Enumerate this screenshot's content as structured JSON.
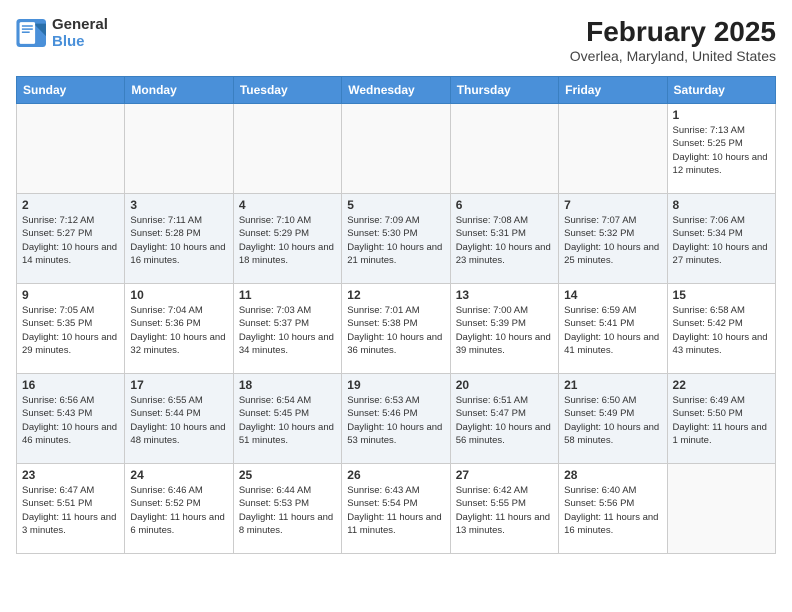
{
  "logo": {
    "name1": "General",
    "name2": "Blue"
  },
  "title": "February 2025",
  "subtitle": "Overlea, Maryland, United States",
  "days_of_week": [
    "Sunday",
    "Monday",
    "Tuesday",
    "Wednesday",
    "Thursday",
    "Friday",
    "Saturday"
  ],
  "weeks": [
    [
      {
        "day": "",
        "info": ""
      },
      {
        "day": "",
        "info": ""
      },
      {
        "day": "",
        "info": ""
      },
      {
        "day": "",
        "info": ""
      },
      {
        "day": "",
        "info": ""
      },
      {
        "day": "",
        "info": ""
      },
      {
        "day": "1",
        "info": "Sunrise: 7:13 AM\nSunset: 5:25 PM\nDaylight: 10 hours and 12 minutes."
      }
    ],
    [
      {
        "day": "2",
        "info": "Sunrise: 7:12 AM\nSunset: 5:27 PM\nDaylight: 10 hours and 14 minutes."
      },
      {
        "day": "3",
        "info": "Sunrise: 7:11 AM\nSunset: 5:28 PM\nDaylight: 10 hours and 16 minutes."
      },
      {
        "day": "4",
        "info": "Sunrise: 7:10 AM\nSunset: 5:29 PM\nDaylight: 10 hours and 18 minutes."
      },
      {
        "day": "5",
        "info": "Sunrise: 7:09 AM\nSunset: 5:30 PM\nDaylight: 10 hours and 21 minutes."
      },
      {
        "day": "6",
        "info": "Sunrise: 7:08 AM\nSunset: 5:31 PM\nDaylight: 10 hours and 23 minutes."
      },
      {
        "day": "7",
        "info": "Sunrise: 7:07 AM\nSunset: 5:32 PM\nDaylight: 10 hours and 25 minutes."
      },
      {
        "day": "8",
        "info": "Sunrise: 7:06 AM\nSunset: 5:34 PM\nDaylight: 10 hours and 27 minutes."
      }
    ],
    [
      {
        "day": "9",
        "info": "Sunrise: 7:05 AM\nSunset: 5:35 PM\nDaylight: 10 hours and 29 minutes."
      },
      {
        "day": "10",
        "info": "Sunrise: 7:04 AM\nSunset: 5:36 PM\nDaylight: 10 hours and 32 minutes."
      },
      {
        "day": "11",
        "info": "Sunrise: 7:03 AM\nSunset: 5:37 PM\nDaylight: 10 hours and 34 minutes."
      },
      {
        "day": "12",
        "info": "Sunrise: 7:01 AM\nSunset: 5:38 PM\nDaylight: 10 hours and 36 minutes."
      },
      {
        "day": "13",
        "info": "Sunrise: 7:00 AM\nSunset: 5:39 PM\nDaylight: 10 hours and 39 minutes."
      },
      {
        "day": "14",
        "info": "Sunrise: 6:59 AM\nSunset: 5:41 PM\nDaylight: 10 hours and 41 minutes."
      },
      {
        "day": "15",
        "info": "Sunrise: 6:58 AM\nSunset: 5:42 PM\nDaylight: 10 hours and 43 minutes."
      }
    ],
    [
      {
        "day": "16",
        "info": "Sunrise: 6:56 AM\nSunset: 5:43 PM\nDaylight: 10 hours and 46 minutes."
      },
      {
        "day": "17",
        "info": "Sunrise: 6:55 AM\nSunset: 5:44 PM\nDaylight: 10 hours and 48 minutes."
      },
      {
        "day": "18",
        "info": "Sunrise: 6:54 AM\nSunset: 5:45 PM\nDaylight: 10 hours and 51 minutes."
      },
      {
        "day": "19",
        "info": "Sunrise: 6:53 AM\nSunset: 5:46 PM\nDaylight: 10 hours and 53 minutes."
      },
      {
        "day": "20",
        "info": "Sunrise: 6:51 AM\nSunset: 5:47 PM\nDaylight: 10 hours and 56 minutes."
      },
      {
        "day": "21",
        "info": "Sunrise: 6:50 AM\nSunset: 5:49 PM\nDaylight: 10 hours and 58 minutes."
      },
      {
        "day": "22",
        "info": "Sunrise: 6:49 AM\nSunset: 5:50 PM\nDaylight: 11 hours and 1 minute."
      }
    ],
    [
      {
        "day": "23",
        "info": "Sunrise: 6:47 AM\nSunset: 5:51 PM\nDaylight: 11 hours and 3 minutes."
      },
      {
        "day": "24",
        "info": "Sunrise: 6:46 AM\nSunset: 5:52 PM\nDaylight: 11 hours and 6 minutes."
      },
      {
        "day": "25",
        "info": "Sunrise: 6:44 AM\nSunset: 5:53 PM\nDaylight: 11 hours and 8 minutes."
      },
      {
        "day": "26",
        "info": "Sunrise: 6:43 AM\nSunset: 5:54 PM\nDaylight: 11 hours and 11 minutes."
      },
      {
        "day": "27",
        "info": "Sunrise: 6:42 AM\nSunset: 5:55 PM\nDaylight: 11 hours and 13 minutes."
      },
      {
        "day": "28",
        "info": "Sunrise: 6:40 AM\nSunset: 5:56 PM\nDaylight: 11 hours and 16 minutes."
      },
      {
        "day": "",
        "info": ""
      }
    ]
  ]
}
